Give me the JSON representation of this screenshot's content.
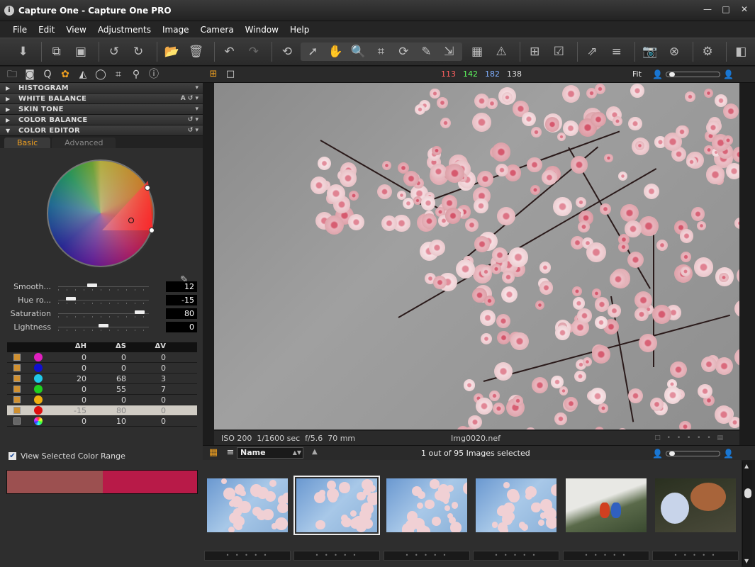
{
  "window": {
    "title": "Capture One - Capture One PRO",
    "minimize": "—",
    "maximize": "□",
    "close": "✕"
  },
  "menu": [
    "File",
    "Edit",
    "View",
    "Adjustments",
    "Image",
    "Camera",
    "Window",
    "Help"
  ],
  "toolbar_icons": [
    "import-icon",
    "capture-icon",
    "edit-icon",
    "rotate-left-icon",
    "rotate-right-icon",
    "folder-icon",
    "trash-icon",
    "undo-icon",
    "redo-icon",
    "reset-icon",
    "pointer-icon",
    "pan-icon",
    "zoom-icon",
    "crop-icon",
    "rotate-icon",
    "picker-icon",
    "pick-icon",
    "grid-icon",
    "warning-icon",
    "new-variant-icon",
    "clone-variant-icon",
    "process-icon",
    "batch-icon",
    "camera-icon",
    "cancel-icon",
    "settings-icon",
    "exposure-icon"
  ],
  "sections": [
    {
      "label": "HISTOGRAM",
      "tail": ""
    },
    {
      "label": "WHITE BALANCE",
      "tail": "A"
    },
    {
      "label": "SKIN TONE",
      "tail": ""
    },
    {
      "label": "COLOR BALANCE",
      "tail": ""
    },
    {
      "label": "COLOR EDITOR",
      "tail": ""
    }
  ],
  "color_editor": {
    "tabs": [
      "Basic",
      "Advanced"
    ],
    "sliders": [
      {
        "label": "Smooth...",
        "value": "12",
        "pos": 0.36
      },
      {
        "label": "Hue ro...",
        "value": "-15",
        "pos": 0.1
      },
      {
        "label": "Saturation",
        "value": "80",
        "pos": 0.95
      },
      {
        "label": "Lightness",
        "value": "0",
        "pos": 0.5
      }
    ],
    "table_headers": [
      "ΔH",
      "ΔS",
      "ΔV"
    ],
    "rows": [
      {
        "color": "#e020c0",
        "h": "0",
        "s": "0",
        "v": "0",
        "checked": true,
        "selected": false
      },
      {
        "color": "#1010d0",
        "h": "0",
        "s": "0",
        "v": "0",
        "checked": true,
        "selected": false
      },
      {
        "color": "#20c8e8",
        "h": "20",
        "s": "68",
        "v": "3",
        "checked": true,
        "selected": false
      },
      {
        "color": "#20d020",
        "h": "0",
        "s": "55",
        "v": "7",
        "checked": true,
        "selected": false
      },
      {
        "color": "#f0b010",
        "h": "0",
        "s": "0",
        "v": "0",
        "checked": true,
        "selected": false
      },
      {
        "color": "#e01010",
        "h": "-15",
        "s": "80",
        "v": "0",
        "checked": true,
        "selected": true
      },
      {
        "color": "rainbow",
        "h": "0",
        "s": "10",
        "v": "0",
        "checked": false,
        "selected": false
      }
    ],
    "view_selected_label": "View Selected Color Range",
    "range_colors": [
      "#9c5050",
      "#b81a48"
    ]
  },
  "viewer": {
    "rgb_r": "113",
    "rgb_g": "142",
    "rgb_b": "182",
    "rgb_l": "138",
    "rgb_colors": [
      "#ff6060",
      "#60ff60",
      "#80b0ff",
      "#dddddd"
    ],
    "zoom": "Fit",
    "iso": "ISO 200",
    "shutter": "1/1600 sec",
    "aperture": "f/5.6",
    "focal": "70 mm",
    "filename": "Img0020.nef"
  },
  "browser": {
    "sort": "Name",
    "selection": "1 out of 95 Images selected",
    "thumbs": [
      {
        "kind": "blossom",
        "selected": false
      },
      {
        "kind": "blossom",
        "selected": true
      },
      {
        "kind": "blossom",
        "selected": false
      },
      {
        "kind": "blossom",
        "selected": false
      },
      {
        "kind": "toys",
        "selected": false
      },
      {
        "kind": "dogs",
        "selected": false
      }
    ]
  }
}
